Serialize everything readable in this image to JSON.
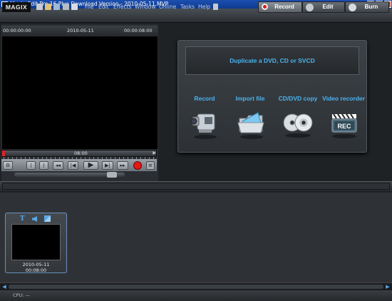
{
  "window": {
    "title": "Movie Edit Pro 16 Plus Download Version - 2010-05-11.MVP",
    "minimize": "_",
    "maximize": "□",
    "close": "✕"
  },
  "menubar": {
    "logo": "MAGIX",
    "toolbar_icons": [
      "new-file-icon",
      "open-folder-icon",
      "save-icon",
      "cut-icon",
      "pointer-icon"
    ],
    "items": [
      "File",
      "Edit",
      "Effects",
      "Window",
      "Online",
      "Tasks",
      "Help"
    ],
    "help_icon": "help-icon"
  },
  "modes": {
    "record": "Record",
    "edit": "Edit",
    "burn": "Burn"
  },
  "player": {
    "time_start": "00:00:00:00",
    "date": "2010-05-11",
    "time_end": "00:00:08:00",
    "scrub_label": "08:00",
    "controls": [
      "prev-marker-icon",
      "next-marker-icon",
      "rewind-icon",
      "skip-start-icon",
      "play-icon",
      "skip-end-icon",
      "fast-forward-icon",
      "record-icon",
      "stop-icon"
    ]
  },
  "import_panel": {
    "duplicate": "Duplicate a DVD, CD or SVCD",
    "options": [
      {
        "label": "Record",
        "icon": "camcorder-icon"
      },
      {
        "label": "Import file",
        "icon": "folder-icon"
      },
      {
        "label": "CD/DVD copy",
        "icon": "discs-icon"
      },
      {
        "label": "Video recorder",
        "icon": "rec-clapper-icon"
      }
    ],
    "rec_text": "REC"
  },
  "clip": {
    "date": "2010-05-11",
    "duration": "00:08:00",
    "tools": [
      "title-icon",
      "audio-icon",
      "effects-icon"
    ],
    "title_glyph": "T"
  },
  "statusbar": {
    "cpu": "CPU: —"
  },
  "colors": {
    "accent_blue": "#4ab3f0",
    "record_red": "#e01818"
  }
}
